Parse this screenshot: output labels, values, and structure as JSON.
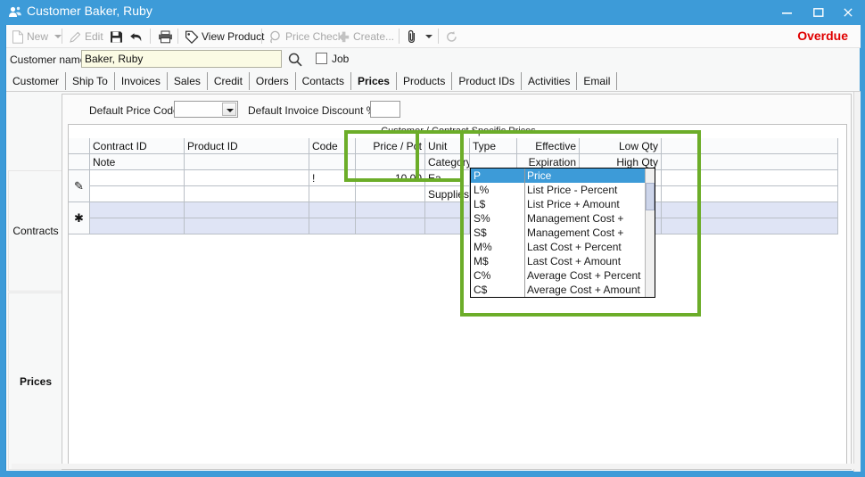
{
  "window": {
    "title": "Customer Baker, Ruby",
    "icon": "customers-icon",
    "minimize": "–",
    "maximize": "☐",
    "close": "×",
    "accent_color": "#3d9bd8"
  },
  "toolbar": {
    "items": [
      {
        "label": "New",
        "icon": "new-document-icon",
        "enabled": false,
        "has_dropdown": true
      },
      {
        "label": "Edit",
        "icon": "pencil-icon",
        "enabled": false,
        "has_dropdown": false
      },
      {
        "label": "",
        "icon": "save-floppy-icon",
        "enabled": true,
        "has_dropdown": false
      },
      {
        "label": "",
        "icon": "undo-arrow-icon",
        "enabled": true,
        "has_dropdown": false
      },
      {
        "label": "",
        "icon": "print-icon",
        "enabled": true,
        "has_dropdown": false
      },
      {
        "label": "View Product",
        "icon": "tag-icon",
        "enabled": true,
        "has_dropdown": false
      },
      {
        "label": "Price Check",
        "icon": "price-check-icon",
        "enabled": false,
        "has_dropdown": false
      },
      {
        "label": "Create...",
        "icon": "plus-icon",
        "enabled": false,
        "has_dropdown": false
      },
      {
        "label": "",
        "icon": "paperclip-icon",
        "enabled": true,
        "has_dropdown": true
      },
      {
        "label": "",
        "icon": "refresh-icon",
        "enabled": false,
        "has_dropdown": false
      }
    ],
    "status": "Overdue",
    "status_color": "#e00000"
  },
  "customer_bar": {
    "label": "Customer name",
    "value": "Baker, Ruby",
    "placeholder": "",
    "search_icon": "magnifier-icon",
    "job_label": "Job",
    "job_checked": false
  },
  "tabs": [
    {
      "label": "Customer",
      "active": false
    },
    {
      "label": "Ship To",
      "active": false
    },
    {
      "label": "Invoices",
      "active": false
    },
    {
      "label": "Sales",
      "active": false
    },
    {
      "label": "Credit",
      "active": false
    },
    {
      "label": "Orders",
      "active": false
    },
    {
      "label": "Contacts",
      "active": false
    },
    {
      "label": "Prices",
      "active": true
    },
    {
      "label": "Products",
      "active": false
    },
    {
      "label": "Product IDs",
      "active": false
    },
    {
      "label": "Activities",
      "active": false
    },
    {
      "label": "Email",
      "active": false
    }
  ],
  "sidebar": {
    "items": [
      {
        "label": "Contracts",
        "active": false
      },
      {
        "label": "Prices",
        "active": true
      }
    ]
  },
  "defaults": {
    "price_code_label": "Default Price Code",
    "price_code_value": "",
    "invoice_discount_label": "Default Invoice Discount %",
    "invoice_discount_value": ""
  },
  "grid": {
    "caption": "Customer / Contract Specific Prices",
    "header_row1": [
      "Contract ID",
      "Product ID",
      "Code",
      "Price / Pct",
      "Unit",
      "Type",
      "Effective",
      "Low Qty",
      ""
    ],
    "header_row2": [
      "Note",
      "",
      "",
      "",
      "Category",
      "",
      "Expiration",
      "High Qty",
      ""
    ],
    "rows": [
      {
        "marker": "pencil-row-icon",
        "line1": {
          "contract_id": "",
          "product_id": "",
          "code": "!",
          "price": "10.00",
          "unit": "Ea",
          "type": "",
          "effective": "",
          "low_qty": "",
          "extra": ""
        },
        "line2": {
          "note": "",
          "category": "Supplies",
          "type": "",
          "expiration": "",
          "high_qty": "",
          "extra": ""
        }
      },
      {
        "marker": "new-row-asterisk-icon",
        "line1": {
          "contract_id": "",
          "product_id": "",
          "code": "",
          "price": "",
          "unit": "",
          "type": "",
          "effective": "",
          "low_qty": "",
          "extra": ""
        },
        "line2": {
          "note": "",
          "category": "",
          "type": "",
          "expiration": "",
          "high_qty": "",
          "extra": ""
        }
      }
    ]
  },
  "type_dropdown": {
    "open": true,
    "selected_index": 0,
    "options": [
      {
        "code": "P",
        "desc": "Price"
      },
      {
        "code": "L%",
        "desc": "List Price - Percent"
      },
      {
        "code": "L$",
        "desc": "List Price + Amount"
      },
      {
        "code": "S%",
        "desc": "Management Cost +"
      },
      {
        "code": "S$",
        "desc": "Management Cost +"
      },
      {
        "code": "M%",
        "desc": "Last Cost + Percent"
      },
      {
        "code": "M$",
        "desc": "Last Cost + Amount"
      },
      {
        "code": "C%",
        "desc": "Average Cost + Percent"
      },
      {
        "code": "C$",
        "desc": "Average Cost + Amount"
      }
    ]
  },
  "annotations": {
    "color": "#6cad29",
    "boxes": [
      {
        "name": "price-pct-column-highlight"
      },
      {
        "name": "unit-category-column-highlight"
      },
      {
        "name": "type-dropdown-highlight"
      }
    ]
  }
}
